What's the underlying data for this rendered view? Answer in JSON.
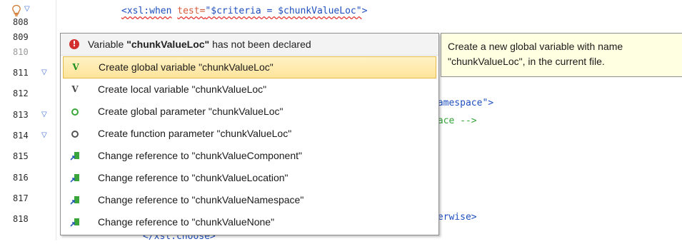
{
  "editor": {
    "first_line_code": {
      "open": "<xsl:when",
      "attr": "test=",
      "value": "\"$criteria = $chunkValueLoc\"",
      "close": ">"
    },
    "line_numbers": [
      "808",
      "809",
      "810",
      "811",
      "812",
      "813",
      "814",
      "815",
      "816",
      "817",
      "818"
    ],
    "right_code": {
      "r1": "Namespace\">",
      "r2": "pace -->",
      "r3": ">",
      "r4": "herwise>",
      "r5": "</xsl:choose>"
    }
  },
  "popup": {
    "header_prefix": "Variable ",
    "header_name": "\"chunkValueLoc\"",
    "header_suffix": " has not been declared",
    "items": [
      {
        "label": "Create global variable \"chunkValueLoc\"",
        "icon": "variable-global-icon"
      },
      {
        "label": "Create local variable \"chunkValueLoc\"",
        "icon": "variable-local-icon"
      },
      {
        "label": "Create global parameter \"chunkValueLoc\"",
        "icon": "parameter-global-icon"
      },
      {
        "label": "Create function parameter \"chunkValueLoc\"",
        "icon": "parameter-function-icon"
      },
      {
        "label": "Change reference to \"chunkValueComponent\"",
        "icon": "change-reference-icon"
      },
      {
        "label": "Change reference to \"chunkValueLocation\"",
        "icon": "change-reference-icon"
      },
      {
        "label": "Change reference to \"chunkValueNamespace\"",
        "icon": "change-reference-icon"
      },
      {
        "label": "Change reference to \"chunkValueNone\"",
        "icon": "change-reference-icon"
      }
    ],
    "selected_index": 0
  },
  "tooltip": {
    "line1": "Create a new global variable with name",
    "line2": "\"chunkValueLoc\", in the current file."
  },
  "colors": {
    "error": "#d32f2f",
    "selection": "#ffe49a",
    "tooltip_bg": "#ffffe1",
    "code_blue": "#1f4fbf"
  }
}
